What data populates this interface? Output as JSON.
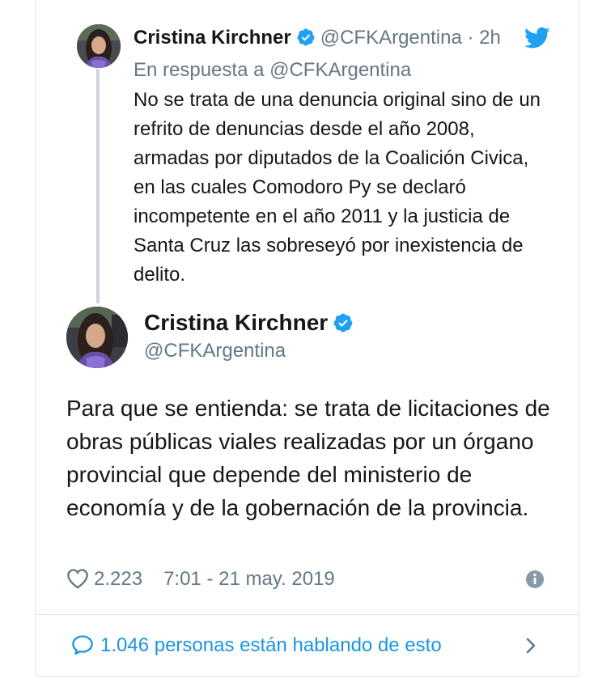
{
  "reply_tweet": {
    "author_name": "Cristina Kirchner",
    "author_handle": "@CFKArgentina",
    "separator": "·",
    "time_ago": "2h",
    "reply_to": "En respuesta a @CFKArgentina",
    "text": "No se trata de una denuncia original sino de un refrito de denuncias desde el año 2008, armadas por diputados de la Coalición Civica, en las cuales Comodoro Py se declaró incompetente en el año 2011 y la justicia de Santa Cruz las sobreseyó por inexistencia de delito."
  },
  "main_tweet": {
    "author_name": "Cristina Kirchner",
    "author_handle": "@CFKArgentina",
    "text": "Para que se entienda: se trata de licitaciones de obras públicas viales realizadas por un órgano provincial que depende del ministerio de economía y de la gobernación de la provincia.",
    "likes": "2.223",
    "timestamp": "7:01 - 21 may. 2019"
  },
  "footer": {
    "talking_text": "1.046 personas están hablando de esto"
  },
  "icons": {
    "verified": "verified-badge-icon",
    "twitter": "twitter-bird-icon",
    "like": "heart-icon",
    "info": "info-icon",
    "conversation": "speech-bubble-icon",
    "chevron": "chevron-right-icon"
  },
  "colors": {
    "twitter_blue": "#1da1f2",
    "link_blue": "#1b95e0",
    "muted_gray": "#657786",
    "text_dark": "#14171a",
    "thread_line": "#ccd6dd",
    "border": "#e1e8ed"
  }
}
